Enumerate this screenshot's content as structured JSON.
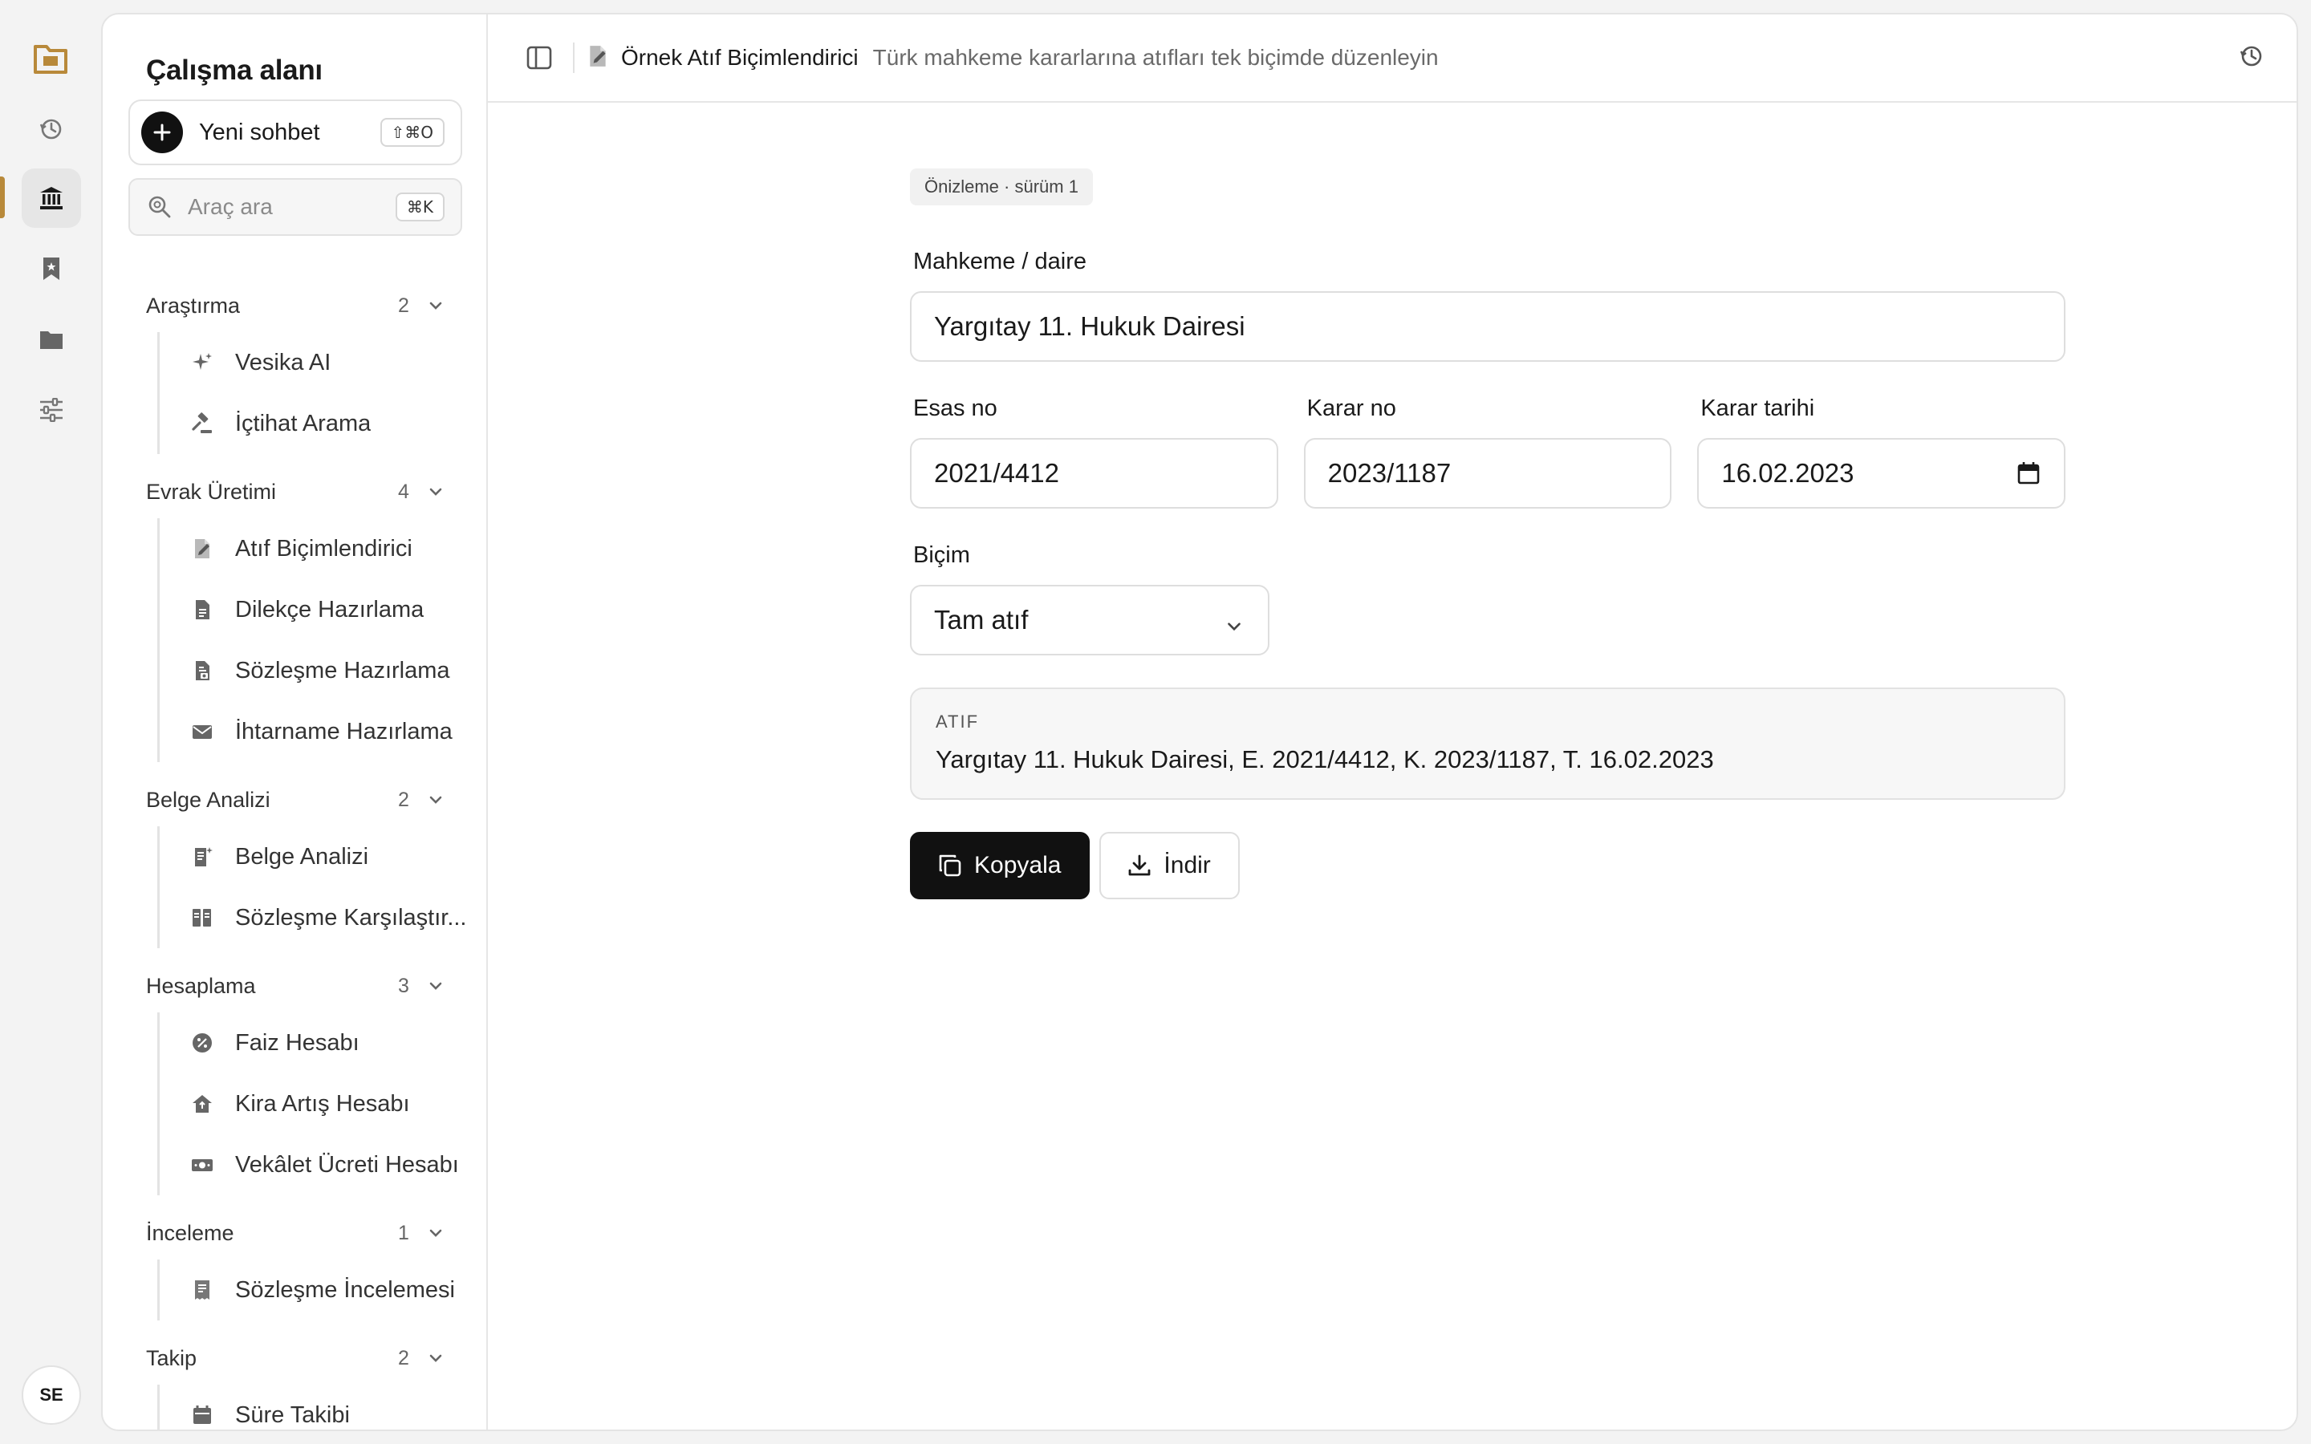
{
  "rail": {
    "avatar_initials": "SE",
    "accent_color": "#b8893a"
  },
  "sidebar": {
    "workspace_title": "Çalışma alanı",
    "new_chat_label": "Yeni sohbet",
    "new_chat_shortcut": "⇧⌘O",
    "search_placeholder": "Araç ara",
    "search_shortcut": "⌘K",
    "groups": [
      {
        "name": "Araştırma",
        "count": "2",
        "items": [
          {
            "label": "Vesika AI",
            "icon": "sparkle-icon"
          },
          {
            "label": "İçtihat Arama",
            "icon": "gavel-icon"
          }
        ]
      },
      {
        "name": "Evrak Üretimi",
        "count": "4",
        "items": [
          {
            "label": "Atıf Biçimlendirici",
            "icon": "document-edit-icon"
          },
          {
            "label": "Dilekçe Hazırlama",
            "icon": "document-icon"
          },
          {
            "label": "Sözleşme Hazırlama",
            "icon": "contract-icon"
          },
          {
            "label": "İhtarname Hazırlama",
            "icon": "envelope-icon"
          }
        ]
      },
      {
        "name": "Belge Analizi",
        "count": "2",
        "items": [
          {
            "label": "Belge Analizi",
            "icon": "document-sparkle-icon"
          },
          {
            "label": "Sözleşme Karşılaştır...",
            "icon": "compare-icon"
          }
        ]
      },
      {
        "name": "Hesaplama",
        "count": "3",
        "items": [
          {
            "label": "Faiz Hesabı",
            "icon": "percent-icon"
          },
          {
            "label": "Kira Artış Hesabı",
            "icon": "house-icon"
          },
          {
            "label": "Vekâlet Ücreti Hesabı",
            "icon": "money-icon"
          }
        ]
      },
      {
        "name": "İnceleme",
        "count": "1",
        "items": [
          {
            "label": "Sözleşme İncelemesi",
            "icon": "receipt-icon"
          }
        ]
      },
      {
        "name": "Takip",
        "count": "2",
        "items": [
          {
            "label": "Süre Takibi",
            "icon": "calendar-icon"
          }
        ]
      }
    ]
  },
  "topbar": {
    "tool_name": "Örnek Atıf Biçimlendirici",
    "tool_description": "Türk mahkeme kararlarına atıfları tek biçimde düzenleyin"
  },
  "form": {
    "badge": "Önizleme · sürüm 1",
    "court_label": "Mahkeme / daire",
    "court_value": "Yargıtay 11. Hukuk Dairesi",
    "esas_label": "Esas no",
    "esas_value": "2021/4412",
    "karar_label": "Karar no",
    "karar_value": "2023/1187",
    "date_label": "Karar tarihi",
    "date_value": "16.02.2023",
    "format_label": "Biçim",
    "format_value": "Tam atıf",
    "result_caption": "ATIF",
    "result_value": "Yargıtay 11. Hukuk Dairesi, E. 2021/4412, K. 2023/1187, T. 16.02.2023",
    "copy_label": "Kopyala",
    "download_label": "İndir"
  }
}
